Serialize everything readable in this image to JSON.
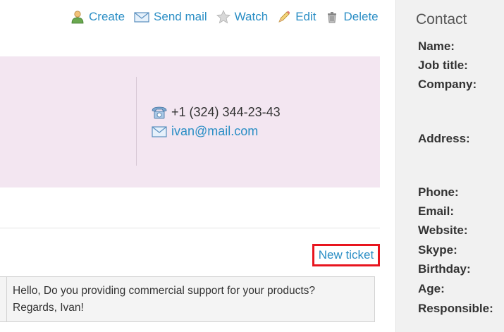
{
  "toolbar": {
    "create": {
      "label": "Create",
      "icon": "user-add-icon"
    },
    "send_mail": {
      "label": "Send mail",
      "icon": "envelope-icon"
    },
    "watch": {
      "label": "Watch",
      "icon": "star-icon"
    },
    "edit": {
      "label": "Edit",
      "icon": "pencil-icon"
    },
    "delete": {
      "label": "Delete",
      "icon": "trash-icon"
    }
  },
  "contact_card": {
    "phone": "+1 (324) 344-23-43",
    "email": "ivan@mail.com"
  },
  "tickets": {
    "new_ticket_label": "New ticket",
    "message_line1": "Hello, Do you providing commercial support for your products?",
    "message_line2": "Regards, Ivan!"
  },
  "sidebar": {
    "title": "Contact",
    "fields": {
      "name": "Name:",
      "job_title": "Job title:",
      "company": "Company:",
      "address": "Address:",
      "phone": "Phone:",
      "email": "Email:",
      "website": "Website:",
      "skype": "Skype:",
      "birthday": "Birthday:",
      "age": "Age:",
      "responsible": "Responsible:"
    }
  },
  "colors": {
    "link": "#2a8ec5",
    "card_background": "#f3e6f1",
    "highlight": "#e8151e",
    "sidebar_background": "#f1f1f1"
  }
}
